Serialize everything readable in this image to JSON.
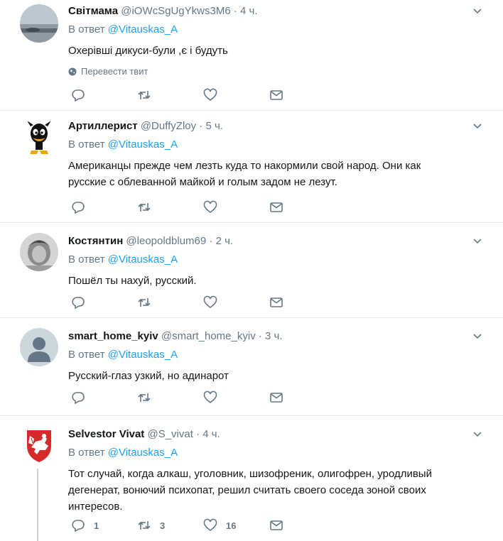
{
  "tweets": [
    {
      "name": "Світмама",
      "handle": "@iOWcSgUgYkws3M6",
      "time": "4 ч.",
      "reply_prefix": "В ответ",
      "reply_to": "@Vitauskas_A",
      "text": "Охерівші дикуси-були ,є і будуть",
      "translate": "Перевести твит",
      "counts": {
        "reply": "",
        "retweet": "",
        "like": ""
      }
    },
    {
      "name": "Артиллерист",
      "handle": "@DuffyZloy",
      "time": "5 ч.",
      "reply_prefix": "В ответ",
      "reply_to": "@Vitauskas_A",
      "text_line1": "Американцы прежде чем лезть куда то накормили свой народ. Они как",
      "text_line2": "русские с облеванной  майкой и голым задом не лезут.",
      "counts": {
        "reply": "",
        "retweet": "",
        "like": ""
      }
    },
    {
      "name": "Костянтин",
      "handle": "@leopoldblum69",
      "time": "2 ч.",
      "reply_prefix": "В ответ",
      "reply_to": "@Vitauskas_A",
      "text": "Пошёл ты нахуй, русский.",
      "counts": {
        "reply": "",
        "retweet": "",
        "like": ""
      }
    },
    {
      "name": "smart_home_kyiv",
      "handle": "@smart_home_kyiv",
      "time": "3 ч.",
      "reply_prefix": "В ответ",
      "reply_to": "@Vitauskas_A",
      "text": "Русский-глаз узкий, но адинарот",
      "counts": {
        "reply": "",
        "retweet": "",
        "like": ""
      }
    },
    {
      "name": "Selvestor Vivat",
      "handle": "@S_vivat",
      "time": "4 ч.",
      "reply_prefix": "В ответ",
      "reply_to": "@Vitauskas_A",
      "text_line1": "Тот случай, когда алкаш, уголовник, шизофреник, олигофрен, уродливый",
      "text_line2": "дегенерат, вонючий психопат, решил считать своего соседа зоной своих",
      "text_line3": "интересов.",
      "counts": {
        "reply": "1",
        "retweet": "3",
        "like": "16"
      }
    }
  ],
  "separator": "·",
  "colors": {
    "link": "#1da1f2",
    "muted": "#657786",
    "text": "#14171a",
    "border": "#e6ecf0"
  }
}
